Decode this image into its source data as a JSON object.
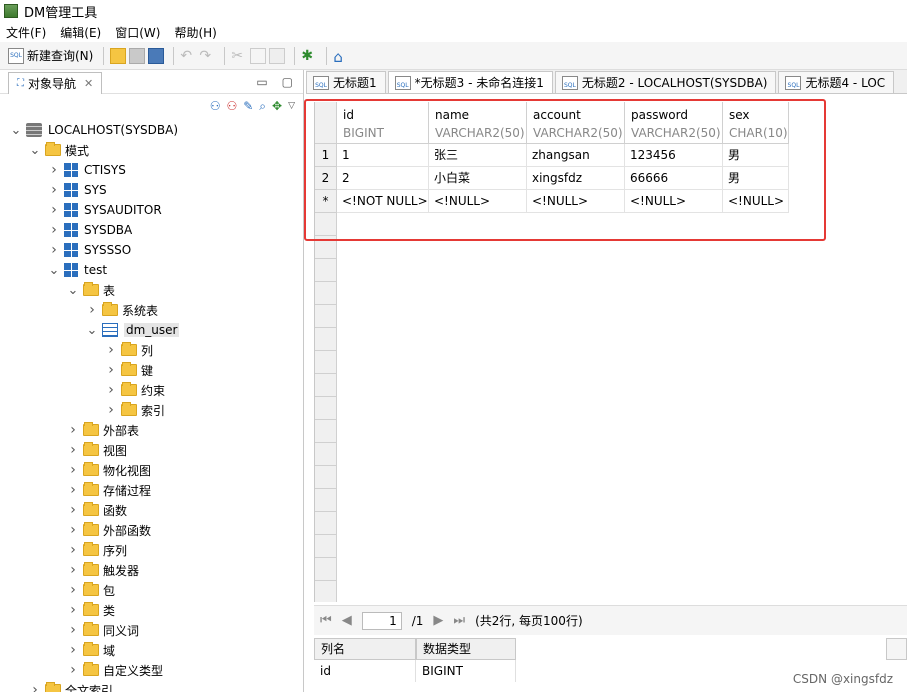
{
  "app": {
    "title": "DM管理工具"
  },
  "menu": [
    "文件(F)",
    "编辑(E)",
    "窗口(W)",
    "帮助(H)"
  ],
  "toolbar": {
    "new_query_label": "新建查询(N)"
  },
  "navigator": {
    "tab_label": "对象导航",
    "tree": [
      {
        "label": "LOCALHOST(SYSDBA)",
        "level": 0,
        "icon": "database-icon",
        "expanded": true
      },
      {
        "label": "模式",
        "level": 1,
        "icon": "folder-icon",
        "expanded": true
      },
      {
        "label": "CTISYS",
        "level": 2,
        "icon": "schema-icon",
        "expanded": false
      },
      {
        "label": "SYS",
        "level": 2,
        "icon": "schema-icon",
        "expanded": false
      },
      {
        "label": "SYSAUDITOR",
        "level": 2,
        "icon": "schema-icon",
        "expanded": false
      },
      {
        "label": "SYSDBA",
        "level": 2,
        "icon": "schema-icon",
        "expanded": false
      },
      {
        "label": "SYSSSO",
        "level": 2,
        "icon": "schema-icon",
        "expanded": false
      },
      {
        "label": "test",
        "level": 2,
        "icon": "schema-icon",
        "expanded": true
      },
      {
        "label": "表",
        "level": 3,
        "icon": "folder-icon",
        "expanded": true
      },
      {
        "label": "系统表",
        "level": 4,
        "icon": "folder-icon",
        "expanded": false
      },
      {
        "label": "dm_user",
        "level": 4,
        "icon": "table-icon",
        "expanded": true,
        "selected": true
      },
      {
        "label": "列",
        "level": 5,
        "icon": "folder-icon",
        "expanded": false
      },
      {
        "label": "键",
        "level": 5,
        "icon": "folder-icon",
        "expanded": false
      },
      {
        "label": "约束",
        "level": 5,
        "icon": "folder-icon",
        "expanded": false
      },
      {
        "label": "索引",
        "level": 5,
        "icon": "folder-icon",
        "expanded": false
      },
      {
        "label": "外部表",
        "level": 3,
        "icon": "folder-icon",
        "expanded": false
      },
      {
        "label": "视图",
        "level": 3,
        "icon": "folder-icon",
        "expanded": false
      },
      {
        "label": "物化视图",
        "level": 3,
        "icon": "folder-icon",
        "expanded": false
      },
      {
        "label": "存储过程",
        "level": 3,
        "icon": "folder-icon",
        "expanded": false
      },
      {
        "label": "函数",
        "level": 3,
        "icon": "folder-icon",
        "expanded": false
      },
      {
        "label": "外部函数",
        "level": 3,
        "icon": "folder-icon",
        "expanded": false
      },
      {
        "label": "序列",
        "level": 3,
        "icon": "folder-icon",
        "expanded": false
      },
      {
        "label": "触发器",
        "level": 3,
        "icon": "folder-icon",
        "expanded": false
      },
      {
        "label": "包",
        "level": 3,
        "icon": "folder-icon",
        "expanded": false
      },
      {
        "label": "类",
        "level": 3,
        "icon": "folder-icon",
        "expanded": false
      },
      {
        "label": "同义词",
        "level": 3,
        "icon": "folder-icon",
        "expanded": false
      },
      {
        "label": "域",
        "level": 3,
        "icon": "folder-icon",
        "expanded": false
      },
      {
        "label": "自定义类型",
        "level": 3,
        "icon": "folder-icon",
        "expanded": false
      },
      {
        "label": "全文索引",
        "level": 1,
        "icon": "folder-icon",
        "expanded": false
      }
    ]
  },
  "editor_tabs": [
    "无标题1",
    "*无标题3 - 未命名连接1",
    "无标题2 - LOCALHOST(SYSDBA)",
    "无标题4 - LOC"
  ],
  "grid": {
    "columns": [
      {
        "name": "id",
        "type": "BIGINT"
      },
      {
        "name": "name",
        "type": "VARCHAR2(50)"
      },
      {
        "name": "account",
        "type": "VARCHAR2(50)"
      },
      {
        "name": "password",
        "type": "VARCHAR2(50)"
      },
      {
        "name": "sex",
        "type": "CHAR(10)"
      }
    ],
    "rows": [
      {
        "num": "1",
        "cells": [
          "1",
          "张三",
          "zhangsan",
          "123456",
          "男"
        ]
      },
      {
        "num": "2",
        "cells": [
          "2",
          "小白菜",
          "xingsfdz",
          "66666",
          "男"
        ]
      },
      {
        "num": "*",
        "cells": [
          "<!NOT NULL>",
          "<!NULL>",
          "<!NULL>",
          "<!NULL>",
          "<!NULL>"
        ]
      }
    ]
  },
  "pager": {
    "page": "1",
    "total_pages": "/1",
    "summary": "(共2行, 每页100行)"
  },
  "detail": {
    "headers": [
      "列名",
      "数据类型"
    ],
    "row": [
      "id",
      "BIGINT"
    ]
  },
  "watermark": "CSDN @xingsfdz"
}
